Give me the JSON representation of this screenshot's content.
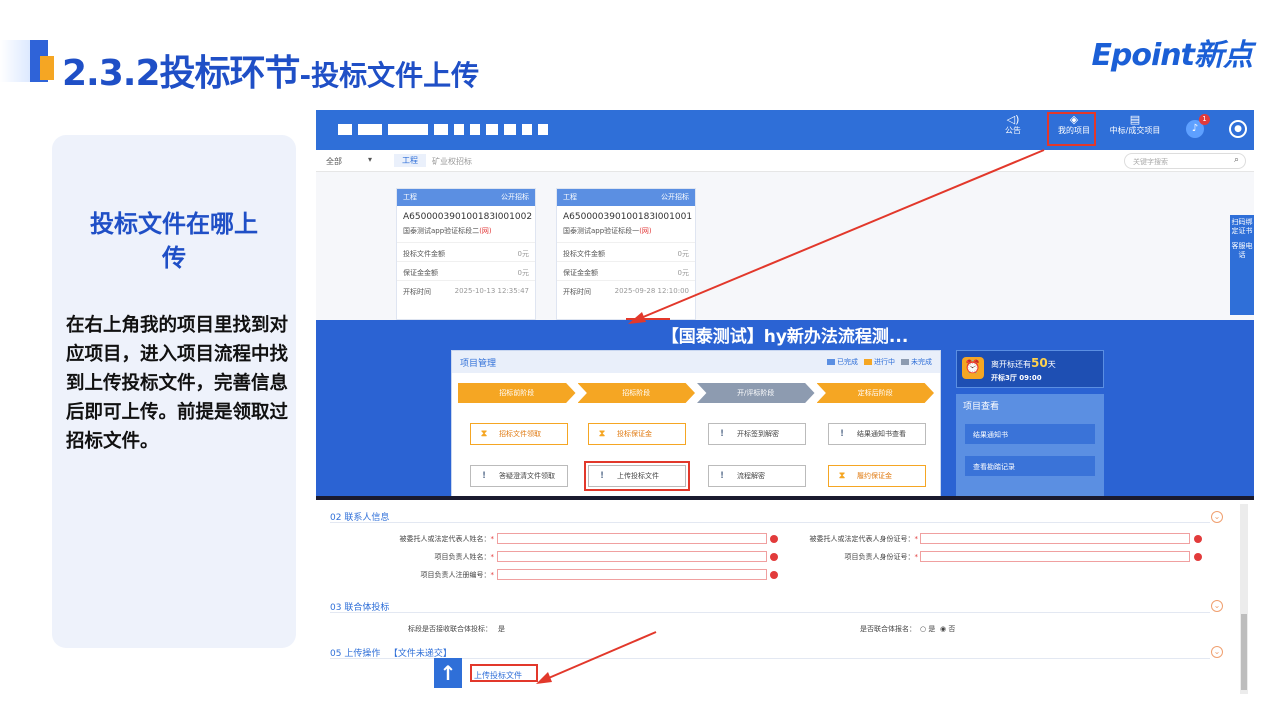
{
  "slide": {
    "title_main": "2.3.2投标环节",
    "title_sub": "-投标文件上传",
    "logo": "Epoint新点"
  },
  "panel": {
    "heading": "投标文件在哪上传",
    "body": "在右上角我的项目里找到对应项目，进入项目流程中找到上传投标文件，完善信息后即可上传。前提是领取过招标文件。"
  },
  "topbar": {
    "nav": [
      {
        "label": "公告",
        "icon": "speaker-icon"
      },
      {
        "label": "我的项目",
        "icon": "layers-icon"
      },
      {
        "label": "中标/成交项目",
        "icon": "document-icon"
      }
    ],
    "bell_count": "1"
  },
  "subbar": {
    "all": "全部",
    "tab": "工程",
    "crumb": "矿业权招标",
    "search_placeholder": "关键字搜索"
  },
  "cards": [
    {
      "type": "工程",
      "mode": "公开招标",
      "code": "A650000390100183I001002",
      "name": "国泰测试app验证标段二",
      "tag": "(网)",
      "rows": [
        [
          "投标文件金额",
          "0元"
        ],
        [
          "保证金金额",
          "0元"
        ],
        [
          "开标时间",
          "2025-10-13 12:35:47"
        ]
      ]
    },
    {
      "type": "工程",
      "mode": "公开招标",
      "code": "A650000390100183I001001",
      "name": "国泰测试app验证标段一",
      "tag": "(网)",
      "rows": [
        [
          "投标文件金额",
          "0元"
        ],
        [
          "保证金金额",
          "0元"
        ],
        [
          "开标时间",
          "2025-09-28 12:10:00"
        ]
      ]
    }
  ],
  "side_tools": [
    "扫码绑定证书",
    "客服电话"
  ],
  "project": {
    "title": "【国泰测试】hy新办法流程测...",
    "mgmt_title": "项目管理",
    "legend": [
      "已完成",
      "进行中",
      "未完成"
    ],
    "stages": [
      "招标前阶段",
      "招标阶段",
      "开/评标阶段",
      "定标后阶段"
    ],
    "buttons_row1": [
      "招标文件领取",
      "投标保证金",
      "开标签到解密",
      "结果通知书查看"
    ],
    "buttons_row2": [
      "答疑澄清文件领取",
      "上传投标文件",
      "流程解密",
      "履约保证金"
    ],
    "countdown_text": "离开标还有",
    "countdown_days": "50",
    "countdown_unit": "天",
    "countdown_time": "开标3厅 09:00",
    "view_title": "项目查看",
    "view_items": [
      "结果通知书",
      "查看勘踏记录"
    ]
  },
  "form": {
    "sec2": "02 联系人信息",
    "f1": "被委托人或法定代表人姓名：",
    "f2": "被委托人或法定代表人身份证号：",
    "f3": "项目负责人姓名：",
    "f4": "项目负责人身份证号：",
    "f5": "项目负责人注册编号：",
    "sec3": "03 联合体投标",
    "q1": "标段是否接收联合体投标：",
    "a1": "是",
    "q2": "是否联合体报名：",
    "opt_no_label": "否",
    "opt_yes_label": "是",
    "sec5_a": "05 上传操作",
    "sec5_b": "【文件未递交】",
    "upload_link": "上传投标文件"
  },
  "colors": {
    "primary": "#2f6fd8",
    "accent": "#f5a623",
    "highlight": "#e2382b",
    "title": "#1f4fc6"
  }
}
